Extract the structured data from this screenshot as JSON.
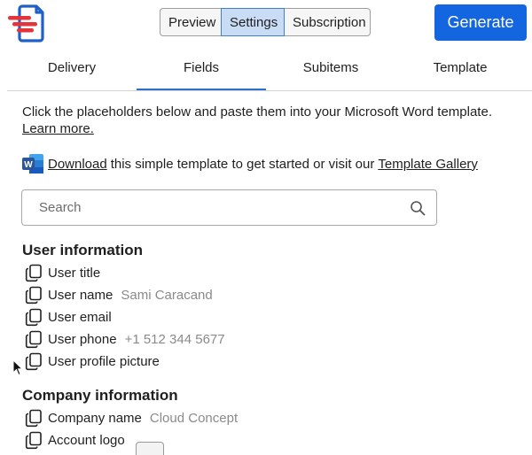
{
  "header": {
    "segments": [
      "Preview",
      "Settings",
      "Subscription"
    ],
    "active_segment": "Settings",
    "generate_label": "Generate"
  },
  "tabs": [
    "Delivery",
    "Fields",
    "Subitems",
    "Template"
  ],
  "active_tab": "Fields",
  "intro": {
    "text": "Click the placeholders below and paste them into your Microsoft Word template.",
    "learn_more": "Learn more."
  },
  "download_row": {
    "download_link": "Download",
    "middle_text": "this simple template to get started or visit our",
    "gallery_link": "Template Gallery"
  },
  "search": {
    "placeholder": "Search"
  },
  "sections": {
    "user": {
      "title": "User information",
      "fields": [
        {
          "label": "User title",
          "value": ""
        },
        {
          "label": "User name",
          "value": "Sami Caracand"
        },
        {
          "label": "User email",
          "value": ""
        },
        {
          "label": "User phone",
          "value": "+1 512 344 5677"
        },
        {
          "label": "User profile picture",
          "value": ""
        }
      ]
    },
    "company": {
      "title": "Company information",
      "fields": [
        {
          "label": "Company name",
          "value": "Cloud Concept"
        },
        {
          "label": "Account logo",
          "value": ""
        }
      ]
    }
  },
  "colors": {
    "primary": "#1466e0",
    "active_segment_bg": "#c9dcf6",
    "logo_red": "#e5333a",
    "logo_blue": "#1f5fc9",
    "word_blue": "#2b579a"
  }
}
